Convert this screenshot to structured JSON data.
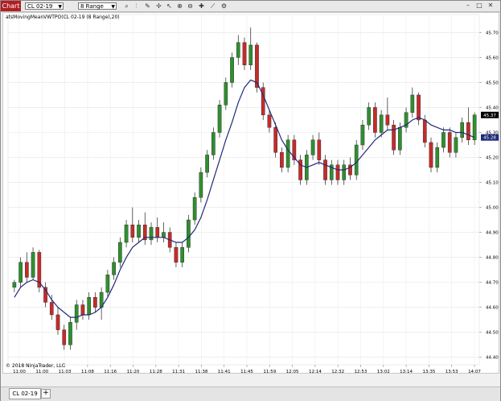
{
  "window": {
    "title": "Chart"
  },
  "toolbar": {
    "instrument": "CL 02-19",
    "bar_type": "8 Range",
    "icons": [
      "search-icon",
      "bar-style-icon",
      "pencil-icon",
      "crosshair-icon",
      "line-draw-icon",
      "arrow-icon",
      "zoom-in-icon",
      "zoom-out-icon",
      "plus-icon",
      "properties-icon"
    ]
  },
  "indicator_label": "atsMovingMeanVWTPO(CL 02-19 (8 Range),20)",
  "copyright": "© 2018 NinjaTrader, LLC",
  "tabs": [
    {
      "label": "CL 02-19"
    }
  ],
  "add_tab_label": "+",
  "colors": {
    "up": "#2f8f2f",
    "down": "#c62b2b",
    "ma": "#1f2a7a",
    "price_box": "#000000",
    "ma_box": "#1f2a7a",
    "title_bg": "#b01e23"
  },
  "chart_data": {
    "type": "candlestick",
    "y_ticks": [
      "45.70",
      "45.60",
      "45.50",
      "45.40",
      "45.30",
      "45.20",
      "45.10",
      "45.00",
      "44.90",
      "44.80",
      "44.70",
      "44.60",
      "44.50",
      "44.40"
    ],
    "x_ticks": [
      "11:00",
      "11:00",
      "11:03",
      "11:08",
      "11:16",
      "11:20",
      "11:28",
      "11:31",
      "11:38",
      "11:41",
      "11:45",
      "11:59",
      "12:05",
      "12:14",
      "12:32",
      "12:53",
      "13:02",
      "13:14",
      "13:35",
      "13:53",
      "14:07"
    ],
    "ylim": [
      44.37,
      45.74
    ],
    "last_price": "45.37",
    "ma_value": "45.28",
    "ohlc": [
      [
        44.68,
        44.71,
        44.66,
        44.7
      ],
      [
        44.7,
        44.8,
        44.68,
        44.78
      ],
      [
        44.78,
        44.82,
        44.7,
        44.72
      ],
      [
        44.72,
        44.84,
        44.71,
        44.82
      ],
      [
        44.82,
        44.83,
        44.66,
        44.68
      ],
      [
        44.68,
        44.7,
        44.6,
        44.62
      ],
      [
        44.62,
        44.65,
        44.55,
        44.57
      ],
      [
        44.57,
        44.6,
        44.49,
        44.51
      ],
      [
        44.51,
        44.53,
        44.43,
        44.45
      ],
      [
        44.45,
        44.56,
        44.43,
        44.54
      ],
      [
        44.54,
        44.63,
        44.51,
        44.61
      ],
      [
        44.61,
        44.63,
        44.55,
        44.57
      ],
      [
        44.57,
        44.66,
        44.55,
        44.64
      ],
      [
        44.64,
        44.66,
        44.58,
        44.6
      ],
      [
        44.6,
        44.68,
        44.55,
        44.66
      ],
      [
        44.66,
        44.75,
        44.64,
        44.73
      ],
      [
        44.73,
        44.8,
        44.71,
        44.78
      ],
      [
        44.78,
        44.88,
        44.76,
        44.86
      ],
      [
        44.86,
        44.95,
        44.84,
        44.93
      ],
      [
        44.93,
        45.0,
        44.86,
        44.88
      ],
      [
        44.88,
        44.95,
        44.86,
        44.93
      ],
      [
        44.93,
        44.98,
        44.85,
        44.87
      ],
      [
        44.87,
        44.94,
        44.85,
        44.92
      ],
      [
        44.92,
        44.96,
        44.86,
        44.88
      ],
      [
        44.88,
        44.94,
        44.86,
        44.9
      ],
      [
        44.9,
        44.92,
        44.82,
        44.84
      ],
      [
        44.84,
        44.86,
        44.76,
        44.78
      ],
      [
        44.78,
        44.86,
        44.76,
        44.84
      ],
      [
        44.84,
        44.97,
        44.82,
        44.95
      ],
      [
        44.95,
        45.06,
        44.93,
        45.04
      ],
      [
        45.04,
        45.16,
        45.02,
        45.14
      ],
      [
        45.14,
        45.23,
        45.12,
        45.21
      ],
      [
        45.21,
        45.32,
        45.19,
        45.3
      ],
      [
        45.3,
        45.43,
        45.28,
        45.41
      ],
      [
        45.41,
        45.52,
        45.39,
        45.5
      ],
      [
        45.5,
        45.62,
        45.48,
        45.6
      ],
      [
        45.6,
        45.69,
        45.57,
        45.66
      ],
      [
        45.66,
        45.68,
        45.55,
        45.57
      ],
      [
        45.57,
        45.72,
        45.55,
        45.65
      ],
      [
        45.65,
        45.66,
        45.46,
        45.48
      ],
      [
        45.48,
        45.5,
        45.35,
        45.37
      ],
      [
        45.37,
        45.39,
        45.3,
        45.32
      ],
      [
        45.32,
        45.34,
        45.2,
        45.22
      ],
      [
        45.22,
        45.24,
        45.14,
        45.16
      ],
      [
        45.16,
        45.29,
        45.14,
        45.27
      ],
      [
        45.27,
        45.29,
        45.17,
        45.19
      ],
      [
        45.19,
        45.21,
        45.09,
        45.11
      ],
      [
        45.11,
        45.23,
        45.09,
        45.21
      ],
      [
        45.21,
        45.29,
        45.19,
        45.27
      ],
      [
        45.27,
        45.3,
        45.17,
        45.19
      ],
      [
        45.19,
        45.21,
        45.09,
        45.11
      ],
      [
        45.11,
        45.19,
        45.09,
        45.17
      ],
      [
        45.17,
        45.19,
        45.09,
        45.11
      ],
      [
        45.11,
        45.19,
        45.09,
        45.17
      ],
      [
        45.17,
        45.2,
        45.11,
        45.13
      ],
      [
        45.13,
        45.27,
        45.11,
        45.25
      ],
      [
        45.25,
        45.35,
        45.23,
        45.33
      ],
      [
        45.33,
        45.42,
        45.31,
        45.4
      ],
      [
        45.4,
        45.42,
        45.28,
        45.3
      ],
      [
        45.3,
        45.39,
        45.28,
        45.37
      ],
      [
        45.37,
        45.44,
        45.31,
        45.33
      ],
      [
        45.33,
        45.35,
        45.21,
        45.23
      ],
      [
        45.23,
        45.34,
        45.21,
        45.32
      ],
      [
        45.32,
        45.4,
        45.3,
        45.38
      ],
      [
        45.38,
        45.48,
        45.36,
        45.45
      ],
      [
        45.45,
        45.46,
        45.33,
        45.35
      ],
      [
        45.35,
        45.37,
        45.24,
        45.26
      ],
      [
        45.26,
        45.28,
        45.14,
        45.16
      ],
      [
        45.16,
        45.26,
        45.14,
        45.24
      ],
      [
        45.24,
        45.32,
        45.22,
        45.3
      ],
      [
        45.3,
        45.32,
        45.2,
        45.22
      ],
      [
        45.22,
        45.3,
        45.2,
        45.28
      ],
      [
        45.28,
        45.36,
        45.26,
        45.34
      ],
      [
        45.34,
        45.4,
        45.25,
        45.27
      ],
      [
        45.27,
        45.38,
        45.25,
        45.37
      ]
    ],
    "ma": [
      44.64,
      44.68,
      44.7,
      44.71,
      44.7,
      44.67,
      44.63,
      44.6,
      44.58,
      44.56,
      44.56,
      44.57,
      44.57,
      44.58,
      44.6,
      44.64,
      44.69,
      44.75,
      44.8,
      44.84,
      44.86,
      44.88,
      44.88,
      44.88,
      44.88,
      44.87,
      44.86,
      44.86,
      44.88,
      44.91,
      44.96,
      45.03,
      45.11,
      45.19,
      45.27,
      45.34,
      45.42,
      45.48,
      45.51,
      45.5,
      45.45,
      45.39,
      45.33,
      45.27,
      45.23,
      45.2,
      45.17,
      45.16,
      45.17,
      45.18,
      45.17,
      45.16,
      45.15,
      45.15,
      45.16,
      45.18,
      45.21,
      45.24,
      45.27,
      45.29,
      45.31,
      45.31,
      45.32,
      45.33,
      45.35,
      45.36,
      45.35,
      45.33,
      45.32,
      45.31,
      45.31,
      45.3,
      45.3,
      45.29,
      45.28
    ]
  }
}
